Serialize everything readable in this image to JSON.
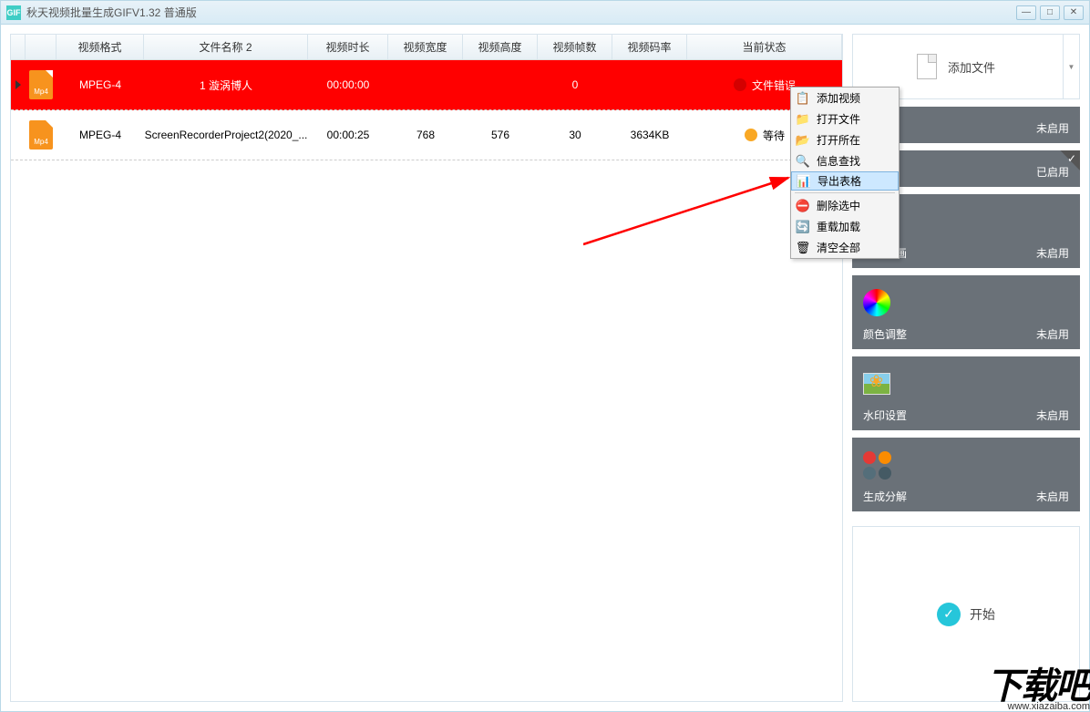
{
  "titlebar": {
    "icon_text": "GIF",
    "title": "秋天视频批量生成GIFV1.32 普通版"
  },
  "table": {
    "headers": {
      "format": "视频格式",
      "name": "文件名称 2",
      "duration": "视频时长",
      "width": "视频宽度",
      "height": "视频高度",
      "fps": "视频帧数",
      "bitrate": "视频码率",
      "status": "当前状态"
    },
    "rows": [
      {
        "selected": true,
        "error": true,
        "format": "MPEG-4",
        "name": "1 漩涡博人",
        "duration": "00:00:00",
        "width": "",
        "height": "",
        "fps": "0",
        "bitrate": "",
        "status": "文件错误",
        "dot": "red"
      },
      {
        "selected": false,
        "error": false,
        "format": "MPEG-4",
        "name": "ScreenRecorderProject2(2020_...",
        "duration": "00:00:25",
        "width": "768",
        "height": "576",
        "fps": "30",
        "bitrate": "3634KB",
        "status": "等待",
        "dot": "orange"
      }
    ]
  },
  "context_menu": {
    "items": [
      {
        "icon": "📋",
        "label": "添加视频"
      },
      {
        "icon": "📁",
        "label": "打开文件"
      },
      {
        "icon": "📂",
        "label": "打开所在"
      },
      {
        "icon": "🔍",
        "label": "信息查找"
      },
      {
        "icon": "📊",
        "label": "导出表格",
        "highlighted": true
      },
      {
        "sep": true
      },
      {
        "icon": "⛔",
        "label": "删除选中"
      },
      {
        "icon": "🔄",
        "label": "重载加载"
      },
      {
        "icon": "🗑",
        "label": "清空全部"
      }
    ]
  },
  "sidebar": {
    "add_file": "添加文件",
    "tools": [
      {
        "label": "",
        "status": "未启用",
        "type": "blank",
        "enabled": false
      },
      {
        "label": "",
        "status": "已启用",
        "type": "crop",
        "enabled": true
      },
      {
        "label": "剪辑动画",
        "status": "未启用",
        "type": "box",
        "enabled": false
      },
      {
        "label": "颜色调整",
        "status": "未启用",
        "type": "color",
        "enabled": false
      },
      {
        "label": "水印设置",
        "status": "未启用",
        "type": "watermark",
        "enabled": false
      },
      {
        "label": "生成分解",
        "status": "未启用",
        "type": "dots",
        "enabled": false
      }
    ],
    "start": "开始"
  },
  "watermark": {
    "main": "下载吧",
    "sub": "www.xiazaiba.com"
  }
}
